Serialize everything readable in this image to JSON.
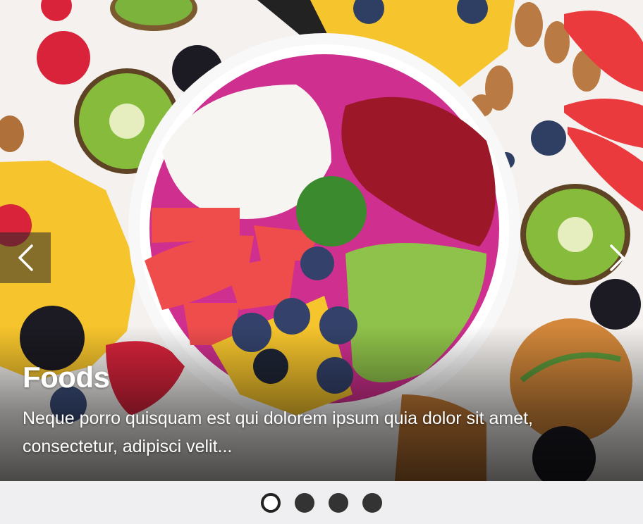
{
  "slide": {
    "title": "Foods",
    "description": "Neque porro quisquam est qui dolorem ipsum quia dolor sit amet, consectetur, adipisci velit...",
    "image_alt": "Bowl of pink smoothie topped with fruits"
  },
  "controls": {
    "prev_icon": "chevron-left-icon",
    "next_icon": "chevron-right-icon"
  },
  "indicators": {
    "count": 4,
    "active_index": 0
  },
  "colors": {
    "caption_text": "#ffffff",
    "dots_bar": "#efeff1",
    "dot_inactive": "#333333",
    "dot_active": "#ffffff"
  }
}
